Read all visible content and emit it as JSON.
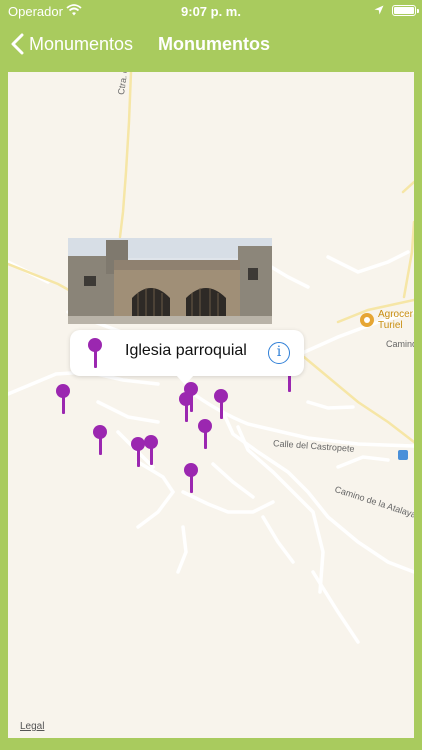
{
  "status_bar": {
    "carrier": "Operador",
    "time": "9:07 p. m.",
    "icons": [
      "wifi-icon",
      "location-icon",
      "battery-icon"
    ]
  },
  "nav": {
    "back_label": "Monumentos",
    "title": "Monumentos"
  },
  "map": {
    "labels": {
      "ctra": "Ctra. d",
      "castropete": "Calle del Castropete",
      "atalaya": "Camino de la Atalaya",
      "agrocer_line1": "Agrocer",
      "agrocer_line2": "Turiel",
      "camino": "Camino"
    },
    "legal": "Legal"
  },
  "callout": {
    "title": "Iglesia parroquial",
    "info_icon": "info-icon"
  },
  "colors": {
    "header": "#a9cb5e",
    "pin": "#9b27b0",
    "info": "#2f7fd7"
  }
}
